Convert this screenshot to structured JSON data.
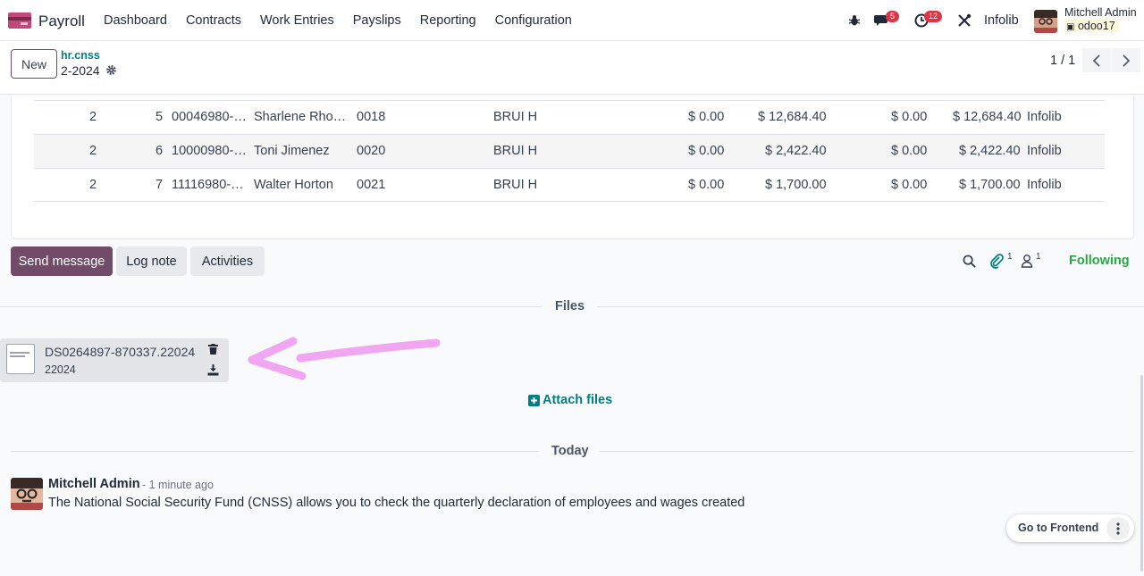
{
  "navbar": {
    "app_name": "Payroll",
    "menu": [
      "Dashboard",
      "Contracts",
      "Work Entries",
      "Payslips",
      "Reporting",
      "Configuration"
    ],
    "messages_badge": "5",
    "activities_badge": "12",
    "company": "Infolib",
    "user_name": "Mitchell Admin",
    "database": "odoo17"
  },
  "control": {
    "new_label": "New",
    "model": "hr.cnss",
    "record": "2-2024",
    "pager": "1 / 1"
  },
  "table": {
    "rows": [
      {
        "c1": "2",
        "c2": "5",
        "c3": "00046980-…",
        "c4": "Sharlene Rho…",
        "c5": "0018",
        "c6": "BRUI H",
        "c7": "$ 0.00",
        "c8": "$ 12,684.40",
        "c9": "$ 0.00",
        "c10": "$ 12,684.40",
        "c11": "Infolib"
      },
      {
        "c1": "2",
        "c2": "6",
        "c3": "10000980-…",
        "c4": "Toni Jimenez",
        "c5": "0020",
        "c6": "BRUI H",
        "c7": "$ 0.00",
        "c8": "$ 2,422.40",
        "c9": "$ 0.00",
        "c10": "$ 2,422.40",
        "c11": "Infolib"
      },
      {
        "c1": "2",
        "c2": "7",
        "c3": "11116980-…",
        "c4": "Walter Horton",
        "c5": "0021",
        "c6": "BRUI H",
        "c7": "$ 0.00",
        "c8": "$ 1,700.00",
        "c9": "$ 0.00",
        "c10": "$ 1,700.00",
        "c11": "Infolib"
      }
    ]
  },
  "chatter": {
    "send_message": "Send message",
    "log_note": "Log note",
    "activities": "Activities",
    "attachments_count": "1",
    "followers_count": "1",
    "following": "Following",
    "files_label": "Files",
    "attachment_name": "DS0264897-870337.22024",
    "attachment_ext": "22024",
    "attach_files": "Attach files",
    "today_label": "Today",
    "message": {
      "author": "Mitchell Admin",
      "time": "- 1 minute ago",
      "body": "The National Social Security Fund (CNSS) allows you to check the quarterly declaration of employees and wages created"
    },
    "go_to_frontend": "Go to Frontend"
  },
  "colors": {
    "brand": "#714b67",
    "link": "#017e84",
    "following": "#28a745",
    "annotation_arrow": "#f0a6f0"
  }
}
